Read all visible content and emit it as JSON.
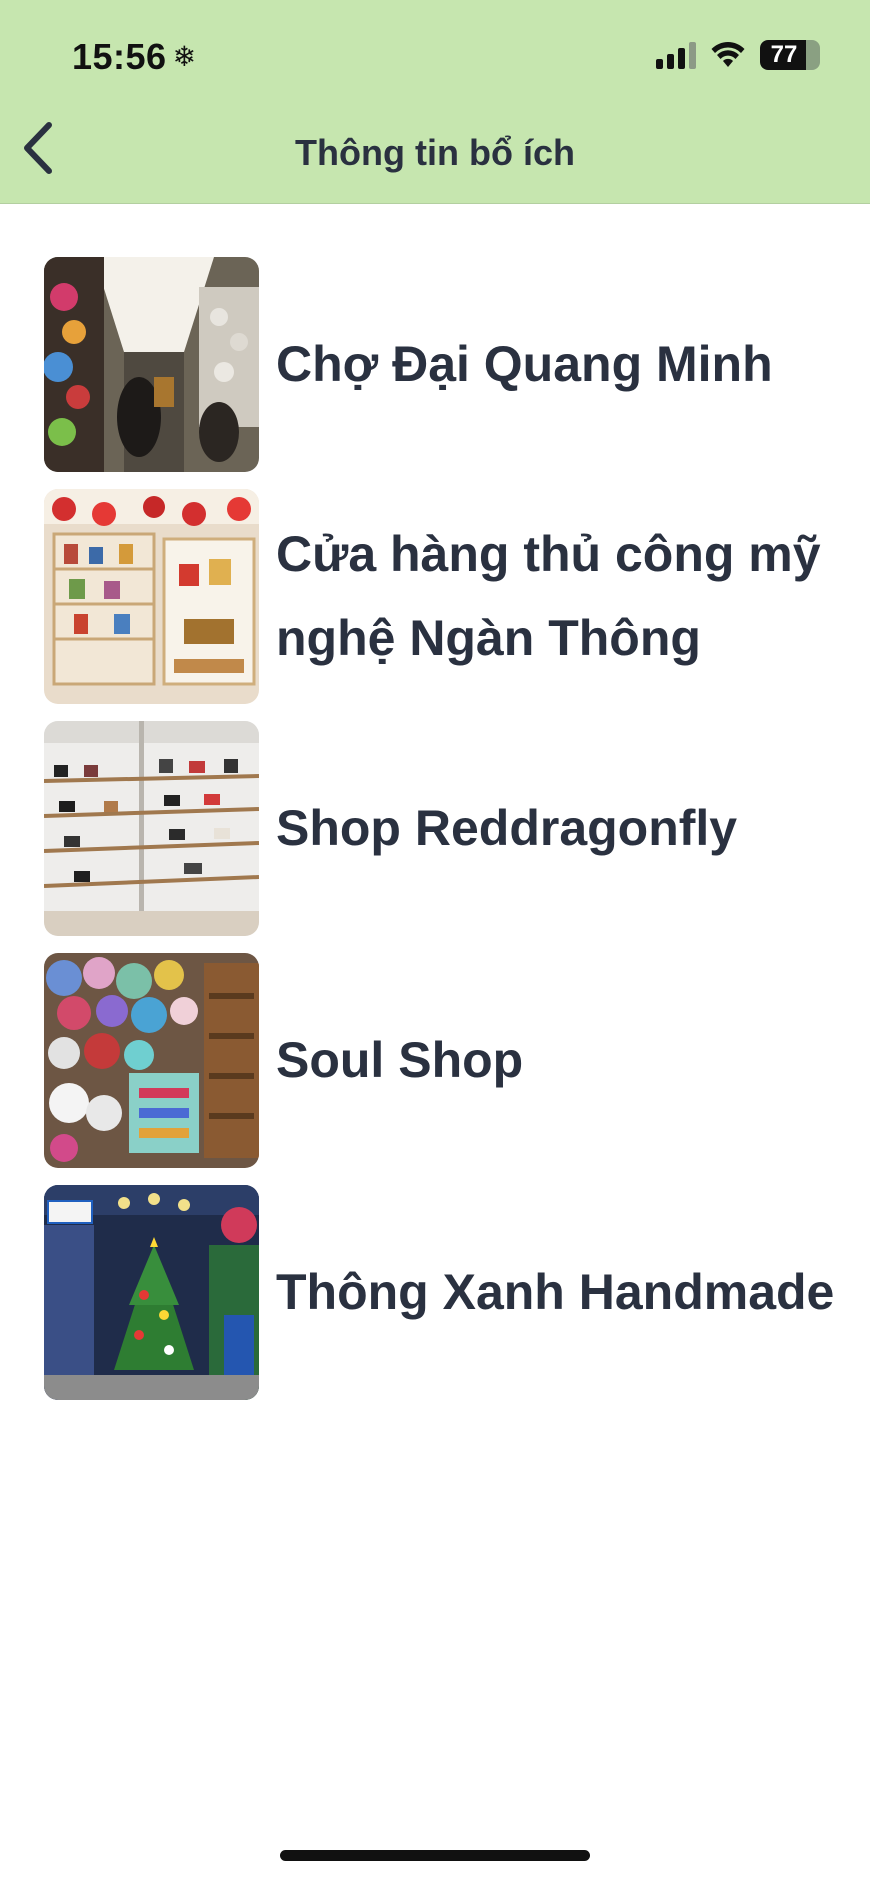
{
  "status_bar": {
    "time": "15:56",
    "battery": "77",
    "battery_level": 0.77
  },
  "header": {
    "title": "Thông tin bổ ích"
  },
  "items": [
    {
      "label": "Chợ Đại Quang Minh",
      "image": "market-alley-photo"
    },
    {
      "label": "Cửa hàng thủ công mỹ nghệ Ngàn Thông",
      "image": "handicraft-shop-photo"
    },
    {
      "label": " Shop Reddragonfly",
      "image": "shoe-shelves-photo"
    },
    {
      "label": "Soul Shop",
      "image": "plush-toys-shop-photo"
    },
    {
      "label": "Thông Xanh Handmade",
      "image": "christmas-tree-shop-photo"
    }
  ],
  "colors": {
    "header_bg": "#c6e6af",
    "text": "#2a3140",
    "page_bg": "#ffffff"
  }
}
